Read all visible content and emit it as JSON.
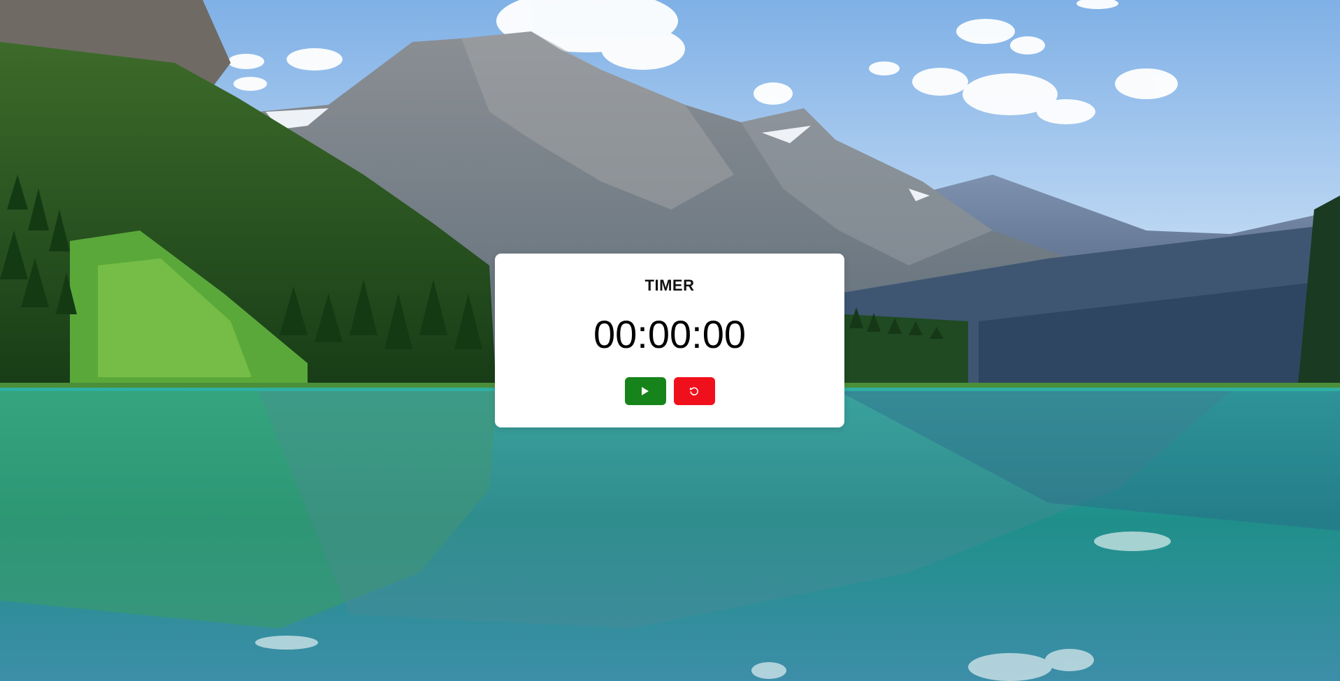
{
  "timer": {
    "title": "TIMER",
    "display": "00:00:00"
  },
  "controls": {
    "start_icon": "play-icon",
    "reset_icon": "reset-icon",
    "start_color": "#16841a",
    "reset_color": "#f0101c"
  },
  "background": {
    "type": "landscape-photo",
    "sky_color": "#a9cdef",
    "water_color": "#2aa39a",
    "forest_color": "#1d4a1c"
  }
}
